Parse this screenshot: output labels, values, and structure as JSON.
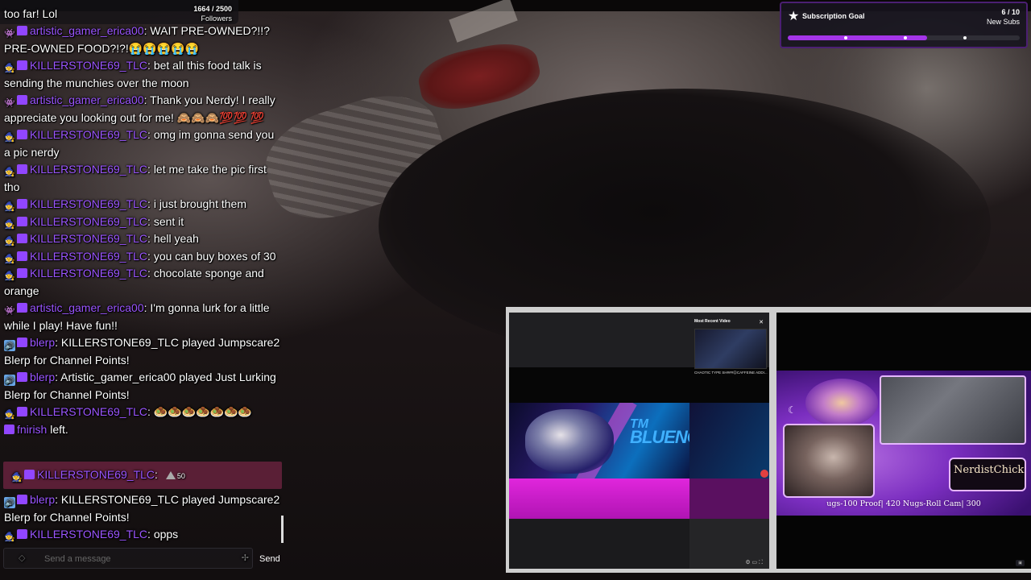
{
  "followers": {
    "count": "1664",
    "goal": "2500",
    "label": "Followers"
  },
  "chat": {
    "top_line": "too far! Lol",
    "messages": [
      {
        "user": "artistic_gamer_erica00",
        "text": "WAIT PRE-OWNED?!!? PRE-OWNED FOOD?!?!😭😭😭😭😭"
      },
      {
        "user": "KILLERSTONE69_TLC",
        "text": "bet all this food talk is sending the munchies over the moon"
      },
      {
        "user": "artistic_gamer_erica00",
        "text": "Thank you Nerdy! I really appreciate you looking out for me! 🙈🙈🙈💯💯 💯"
      },
      {
        "user": "KILLERSTONE69_TLC",
        "text": "omg im gonna send you a pic nerdy"
      },
      {
        "user": "KILLERSTONE69_TLC",
        "text": "let me take the pic first tho"
      },
      {
        "user": "KILLERSTONE69_TLC",
        "text": "i just brought them"
      },
      {
        "user": "KILLERSTONE69_TLC",
        "text": "sent it"
      },
      {
        "user": "KILLERSTONE69_TLC",
        "text": "hell yeah"
      },
      {
        "user": "KILLERSTONE69_TLC",
        "text": "you can buy boxes of 30"
      },
      {
        "user": "KILLERSTONE69_TLC",
        "text": "chocolate sponge and orange"
      },
      {
        "user": "artistic_gamer_erica00",
        "text": "I'm gonna lurk for a little while I play! Have fun!!"
      },
      {
        "user": "blerp",
        "text": "KILLERSTONE69_TLC played Jumpscare2 Blerp for Channel Points!"
      },
      {
        "user": "blerp",
        "text": "Artistic_gamer_erica00 played Just Lurking Blerp for Channel Points!"
      },
      {
        "user": "KILLERSTONE69_TLC",
        "text": "🧆🧆🧆🧆🧆🧆🧆"
      },
      {
        "user": "fnirish",
        "text": "left."
      }
    ],
    "highlight": {
      "user": "KILLERSTONE69_TLC",
      "bits": "50"
    },
    "after": [
      {
        "user": "blerp",
        "text": "KILLERSTONE69_TLC played Jumpscare2 Blerp for Channel Points!"
      },
      {
        "user": "KILLERSTONE69_TLC",
        "text": "opps"
      }
    ],
    "input_placeholder": "Send a message",
    "send_label": "Send"
  },
  "goal": {
    "title": "Subscription Goal",
    "current": "6",
    "target": "10",
    "target_label": "New Subs",
    "progress": 0.6
  },
  "panel_left": {
    "recent_title": "Most Recent Video",
    "recent_caption": "CHAOTIC TYPE SH###☹CAFFEINE ADDI...",
    "brand_small": "TM",
    "brand": "BLUENOTEZ"
  },
  "panel_right": {
    "name": "NerdistChick",
    "ticker": "ugs-100 Proof| 420 Nugs-Roll Cam| 300"
  }
}
